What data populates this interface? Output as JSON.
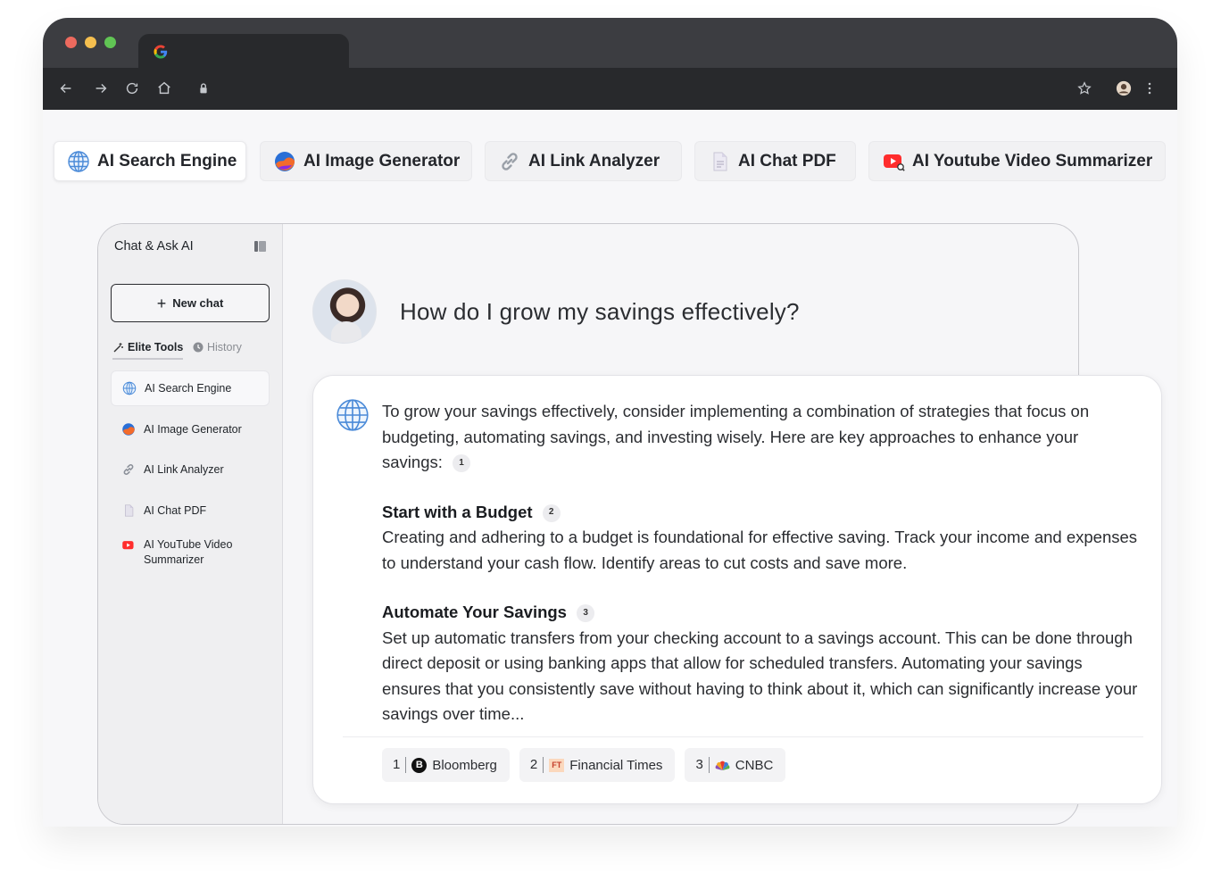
{
  "tools": [
    {
      "label": "AI Search Engine",
      "icon": "globe-icon",
      "active": true
    },
    {
      "label": "AI Image Generator",
      "icon": "image-generator-icon",
      "active": false
    },
    {
      "label": "AI Link Analyzer",
      "icon": "link-icon",
      "active": false
    },
    {
      "label": "AI Chat PDF",
      "icon": "pdf-icon",
      "active": false
    },
    {
      "label": "AI Youtube Video Summarizer",
      "icon": "youtube-icon",
      "active": false
    }
  ],
  "sidebar": {
    "title": "Chat & Ask AI",
    "new_chat": "New chat",
    "tabs": {
      "elite": "Elite Tools",
      "history": "History"
    },
    "items": [
      {
        "label": "AI Search Engine",
        "icon": "globe-icon"
      },
      {
        "label": "AI Image Generator",
        "icon": "image-generator-icon"
      },
      {
        "label": "AI Link Analyzer",
        "icon": "link-icon"
      },
      {
        "label": "AI Chat PDF",
        "icon": "pdf-icon"
      },
      {
        "label": "AI YouTube Video Summarizer",
        "icon": "youtube-icon"
      }
    ]
  },
  "chat": {
    "question": "How do I grow my savings effectively?",
    "intro": "To grow your savings effectively, consider implementing a combination of strategies that focus on budgeting, automating savings, and investing wisely. Here are key approaches to enhance your savings:",
    "intro_ref": "1",
    "sections": [
      {
        "heading": "Start with a Budget",
        "ref": "2",
        "body": "Creating and adhering to a budget is foundational for effective saving. Track your income and expenses to understand your cash flow. Identify areas to cut costs and save more."
      },
      {
        "heading": "Automate Your Savings",
        "ref": "3",
        "body": "Set up automatic transfers from your checking account to a savings account. This can be done through direct deposit or using banking apps that allow for scheduled transfers. Automating your savings ensures that you consistently save without having to think about it, which can significantly increase your savings over time..."
      }
    ],
    "sources": [
      {
        "num": "1",
        "name": "Bloomberg",
        "icon": "bloomberg-icon"
      },
      {
        "num": "2",
        "name": "Financial Times",
        "icon": "financial-times-icon"
      },
      {
        "num": "3",
        "name": "CNBC",
        "icon": "cnbc-icon"
      }
    ]
  },
  "colors": {
    "titlebar": "#3c3d41",
    "toolbar": "#28292c",
    "youtube_red": "#ff2d2d",
    "accent_blue": "#3f7fd9"
  }
}
